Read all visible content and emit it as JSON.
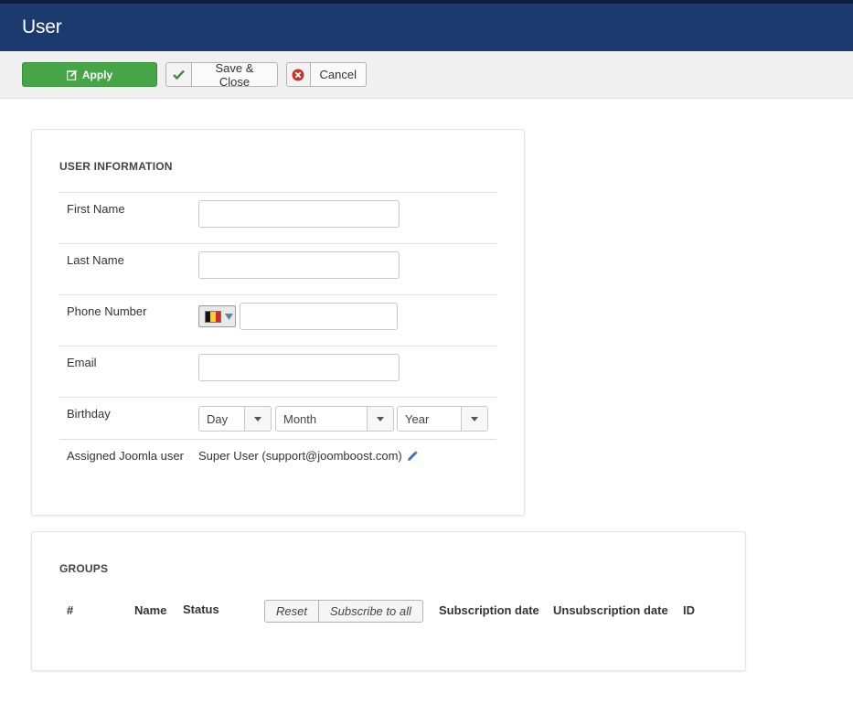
{
  "header": {
    "title": "User"
  },
  "toolbar": {
    "apply_label": "Apply",
    "save_close_label": "Save & Close",
    "cancel_label": "Cancel"
  },
  "user_info": {
    "heading": "USER INFORMATION",
    "first_name": {
      "label": "First Name",
      "value": ""
    },
    "last_name": {
      "label": "Last Name",
      "value": ""
    },
    "phone": {
      "label": "Phone Number",
      "value": "",
      "country_flag": "belgium-flag-icon"
    },
    "email": {
      "label": "Email",
      "value": ""
    },
    "birthday": {
      "label": "Birthday",
      "day": "Day",
      "month": "Month",
      "year": "Year"
    },
    "joomla_user": {
      "label": "Assigned Joomla user",
      "value": "Super User (support@joomboost.com)"
    }
  },
  "groups": {
    "heading": "GROUPS",
    "columns": {
      "num": "#",
      "name": "Name",
      "status": "Status",
      "subscription_date": "Subscription date",
      "unsubscription_date": "Unsubscription date",
      "id": "ID"
    },
    "reset_label": "Reset",
    "subscribe_all_label": "Subscribe to all"
  },
  "colors": {
    "header_bg": "#1d3a6e",
    "apply_green": "#46a546",
    "check_green": "#3b8d3b",
    "cancel_red": "#c0392b",
    "edit_blue": "#3a6fb7"
  }
}
